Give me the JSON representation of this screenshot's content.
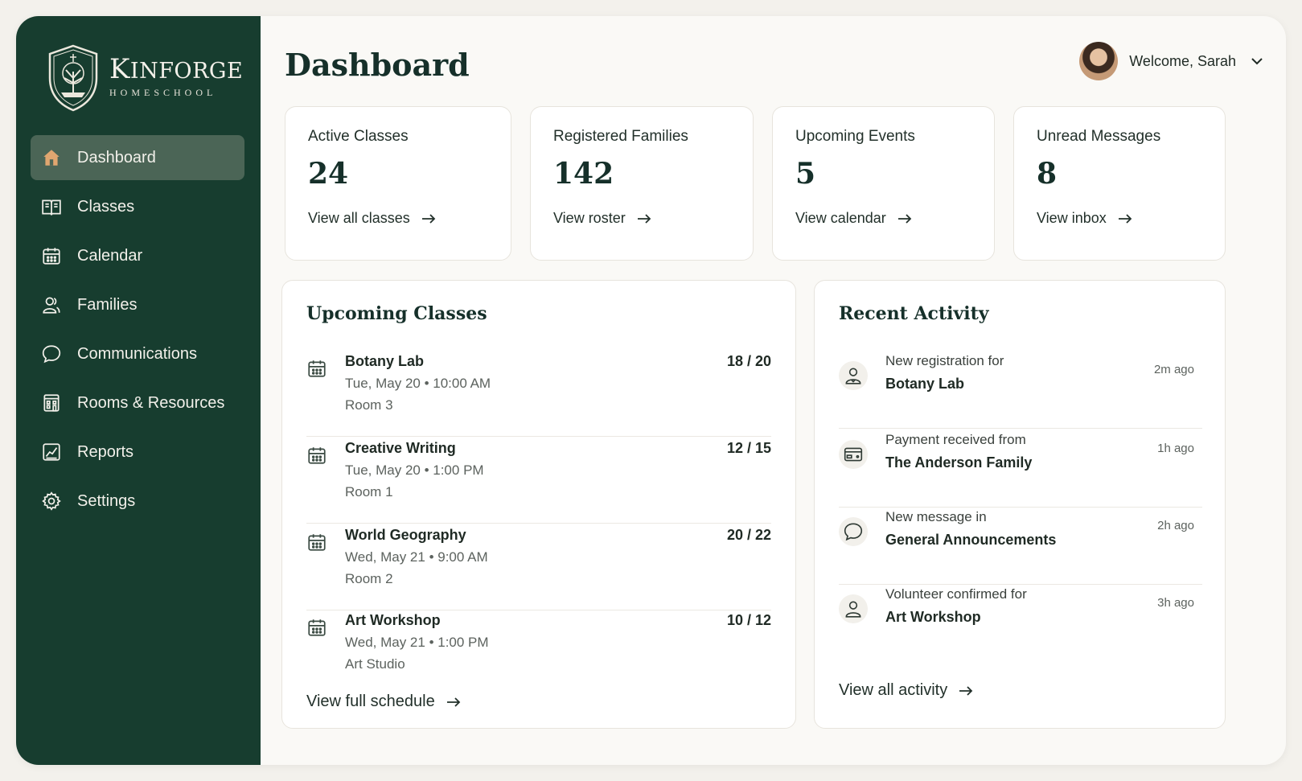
{
  "brand": {
    "name_first": "K",
    "name_rest": "INFORGE",
    "subtitle": "HOMESCHOOL"
  },
  "sidebar": {
    "items": [
      {
        "label": "Dashboard",
        "icon": "home-icon",
        "active": true
      },
      {
        "label": "Classes",
        "icon": "book-icon"
      },
      {
        "label": "Calendar",
        "icon": "calendar-icon"
      },
      {
        "label": "Families",
        "icon": "users-icon"
      },
      {
        "label": "Communications",
        "icon": "chat-bubble-icon"
      },
      {
        "label": "Rooms & Resources",
        "icon": "building-icon"
      },
      {
        "label": "Reports",
        "icon": "chart-icon"
      },
      {
        "label": "Settings",
        "icon": "gear-icon"
      }
    ]
  },
  "header": {
    "title": "Dashboard",
    "welcome": "Welcome, Sarah"
  },
  "stats": [
    {
      "label": "Active Classes",
      "value": "24",
      "link": "View all classes"
    },
    {
      "label": "Registered Families",
      "value": "142",
      "link": "View roster"
    },
    {
      "label": "Upcoming Events",
      "value": "5",
      "link": "View calendar"
    },
    {
      "label": "Unread Messages",
      "value": "8",
      "link": "View inbox"
    }
  ],
  "upcoming": {
    "title": "Upcoming Classes",
    "classes": [
      {
        "name": "Botany Lab",
        "when": "Tue, May 20 • 10:00 AM",
        "room": "Room 3",
        "count": "18 / 20"
      },
      {
        "name": "Creative Writing",
        "when": "Tue, May 20 • 1:00 PM",
        "room": "Room 1",
        "count": "12 / 15"
      },
      {
        "name": "World Geography",
        "when": "Wed, May 21 • 9:00 AM",
        "room": "Room 2",
        "count": "20 / 22"
      },
      {
        "name": "Art Workshop",
        "when": "Wed, May 21 • 1:00 PM",
        "room": "Art Studio",
        "count": "10 / 12"
      }
    ],
    "link": "View full schedule"
  },
  "activity": {
    "title": "Recent Activity",
    "items": [
      {
        "line1": "New registration for",
        "line2": "Botany Lab",
        "time": "2m ago",
        "icon": "user-badge-icon"
      },
      {
        "line1": "Payment received from",
        "line2": "The Anderson Family",
        "time": "1h ago",
        "icon": "card-icon"
      },
      {
        "line1": "New message in",
        "line2": "General Announcements",
        "time": "2h ago",
        "icon": "chat-bubble-icon"
      },
      {
        "line1": "Volunteer confirmed for",
        "line2": "Art Workshop",
        "time": "3h ago",
        "icon": "user-icon"
      }
    ],
    "link": "View all activity"
  }
}
